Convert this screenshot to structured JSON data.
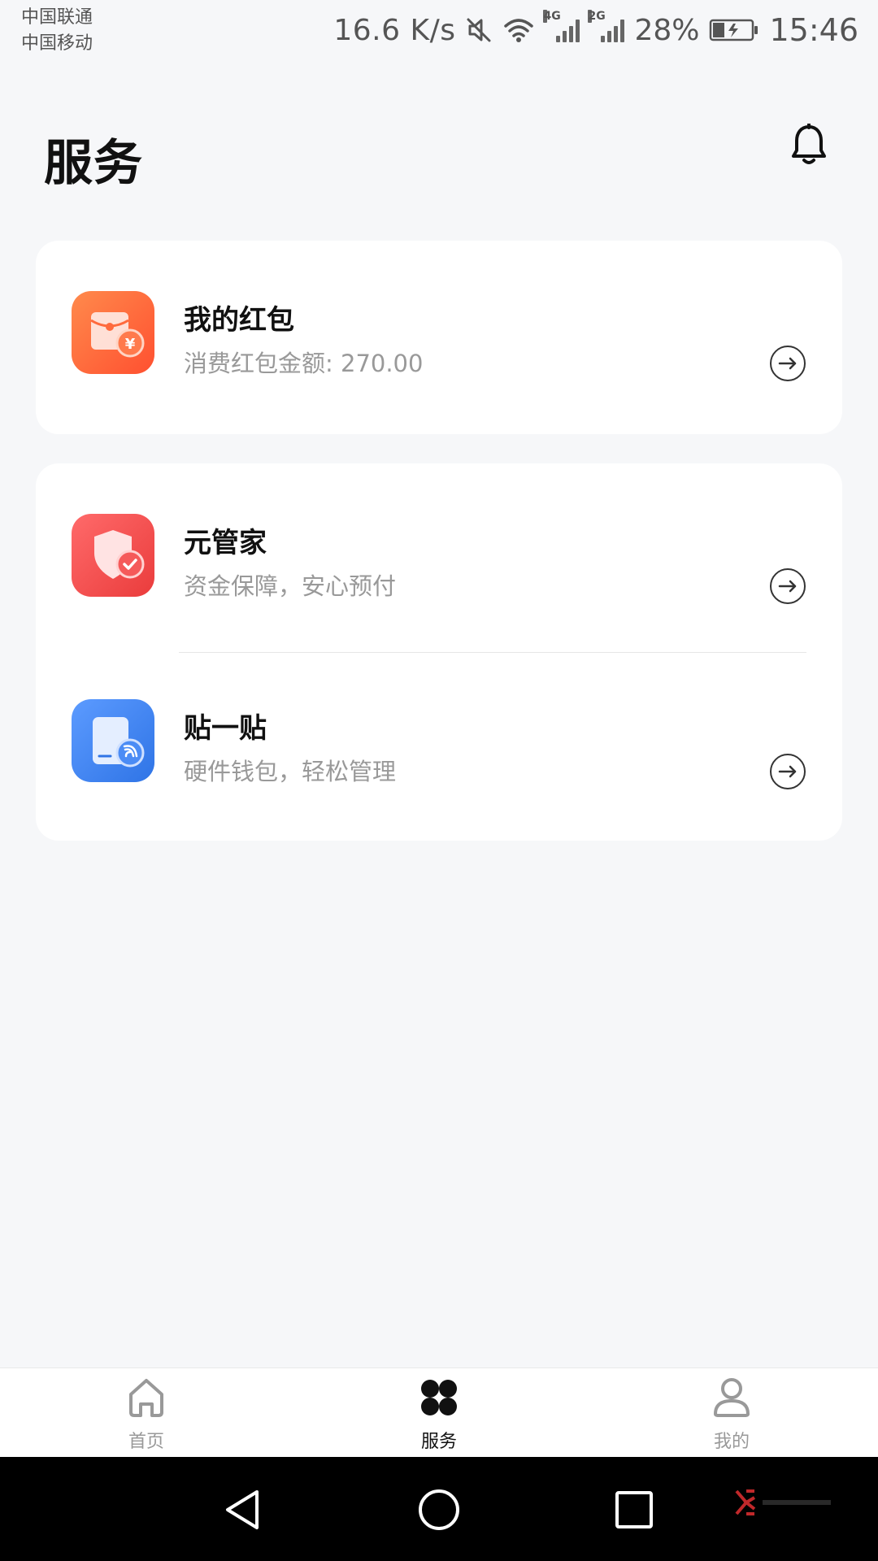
{
  "status_bar": {
    "carrier_1": "中国联通",
    "carrier_2": "中国移动",
    "net_speed": "16.6 K/s",
    "signal_1_label": "4G",
    "signal_2_label": "2G",
    "battery": "28%",
    "time": "15:46",
    "icons": [
      "mute-icon",
      "wifi-icon",
      "signal-icon",
      "battery-charging-icon"
    ]
  },
  "header": {
    "title": "服务",
    "notification_icon": "bell-icon"
  },
  "services": [
    {
      "title": "我的红包",
      "subtitle": "消费红包金额: 270.00",
      "icon": "red-packet-icon",
      "color": "#ff6a3d"
    },
    {
      "title": "元管家",
      "subtitle": "资金保障，安心预付",
      "icon": "shield-check-icon",
      "color": "#f44848"
    },
    {
      "title": "贴一贴",
      "subtitle": "硬件钱包，轻松管理",
      "icon": "nfc-card-icon",
      "color": "#3f86f0"
    }
  ],
  "bottom_nav": {
    "items": [
      {
        "label": "首页",
        "icon": "home-icon",
        "active": false
      },
      {
        "label": "服务",
        "icon": "services-grid-icon",
        "active": true
      },
      {
        "label": "我的",
        "icon": "user-icon",
        "active": false
      }
    ]
  },
  "system_nav": [
    "back-icon",
    "home-circle-icon",
    "recents-icon"
  ]
}
